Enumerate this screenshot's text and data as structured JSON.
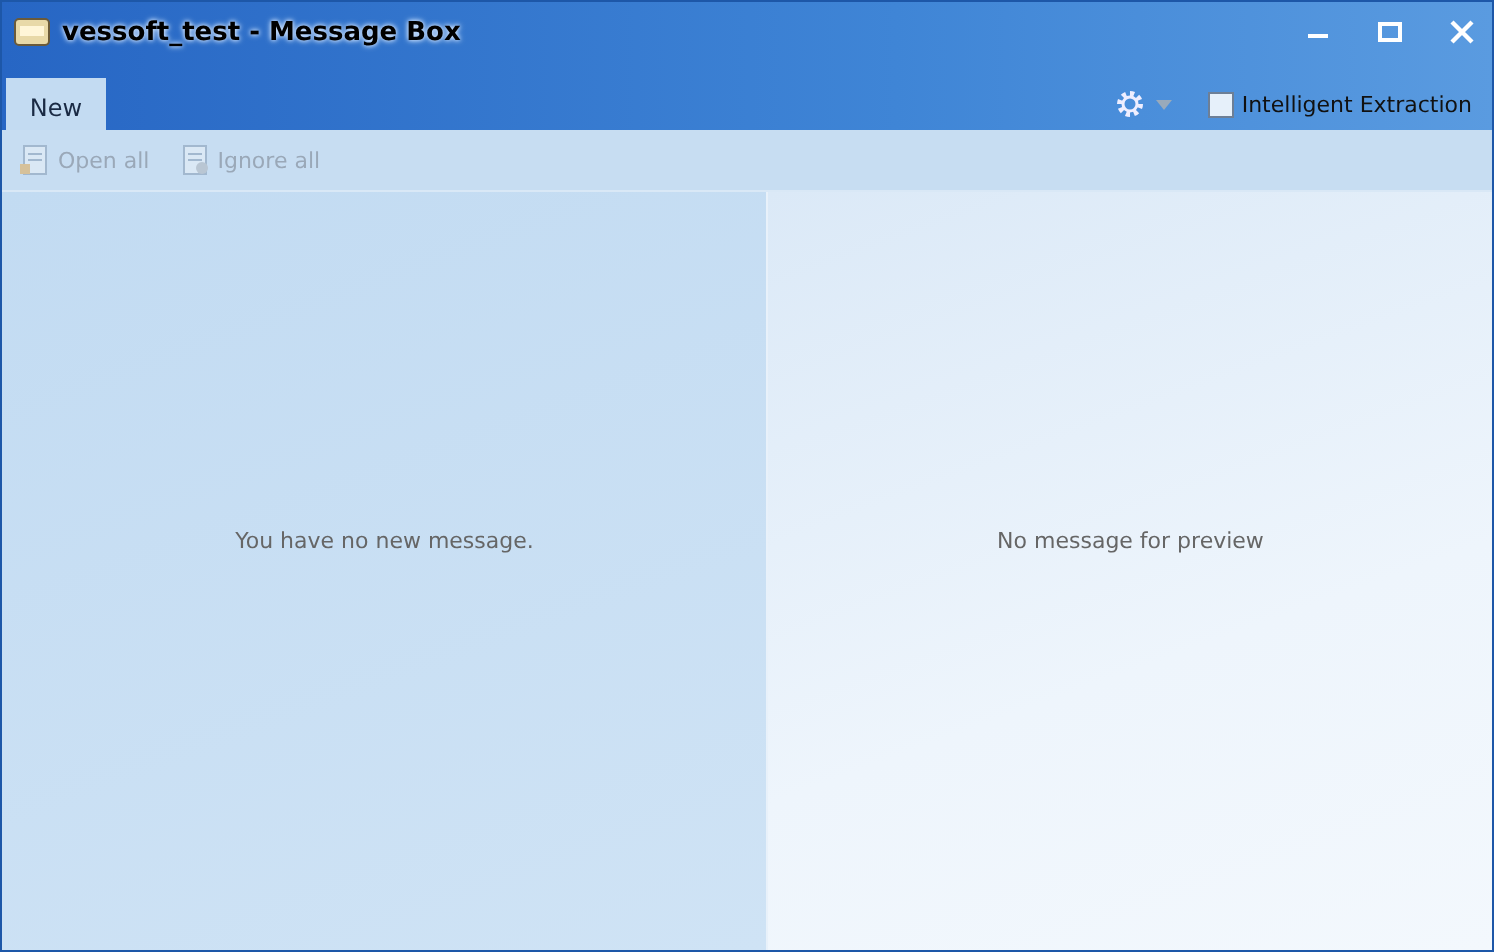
{
  "window": {
    "title": "vessoft_test - Message Box"
  },
  "tabs": [
    {
      "label": "New",
      "selected": true
    }
  ],
  "options": {
    "extraction": {
      "label": "Intelligent Extraction",
      "checked": false
    }
  },
  "toolbar": [
    {
      "label": "Open all",
      "kind": "open",
      "disabled": true
    },
    {
      "label": "Ignore all",
      "kind": "ignore",
      "disabled": true
    }
  ],
  "message_list": {
    "empty_text": "You have no new message."
  },
  "preview": {
    "empty_text": "No message for preview"
  }
}
